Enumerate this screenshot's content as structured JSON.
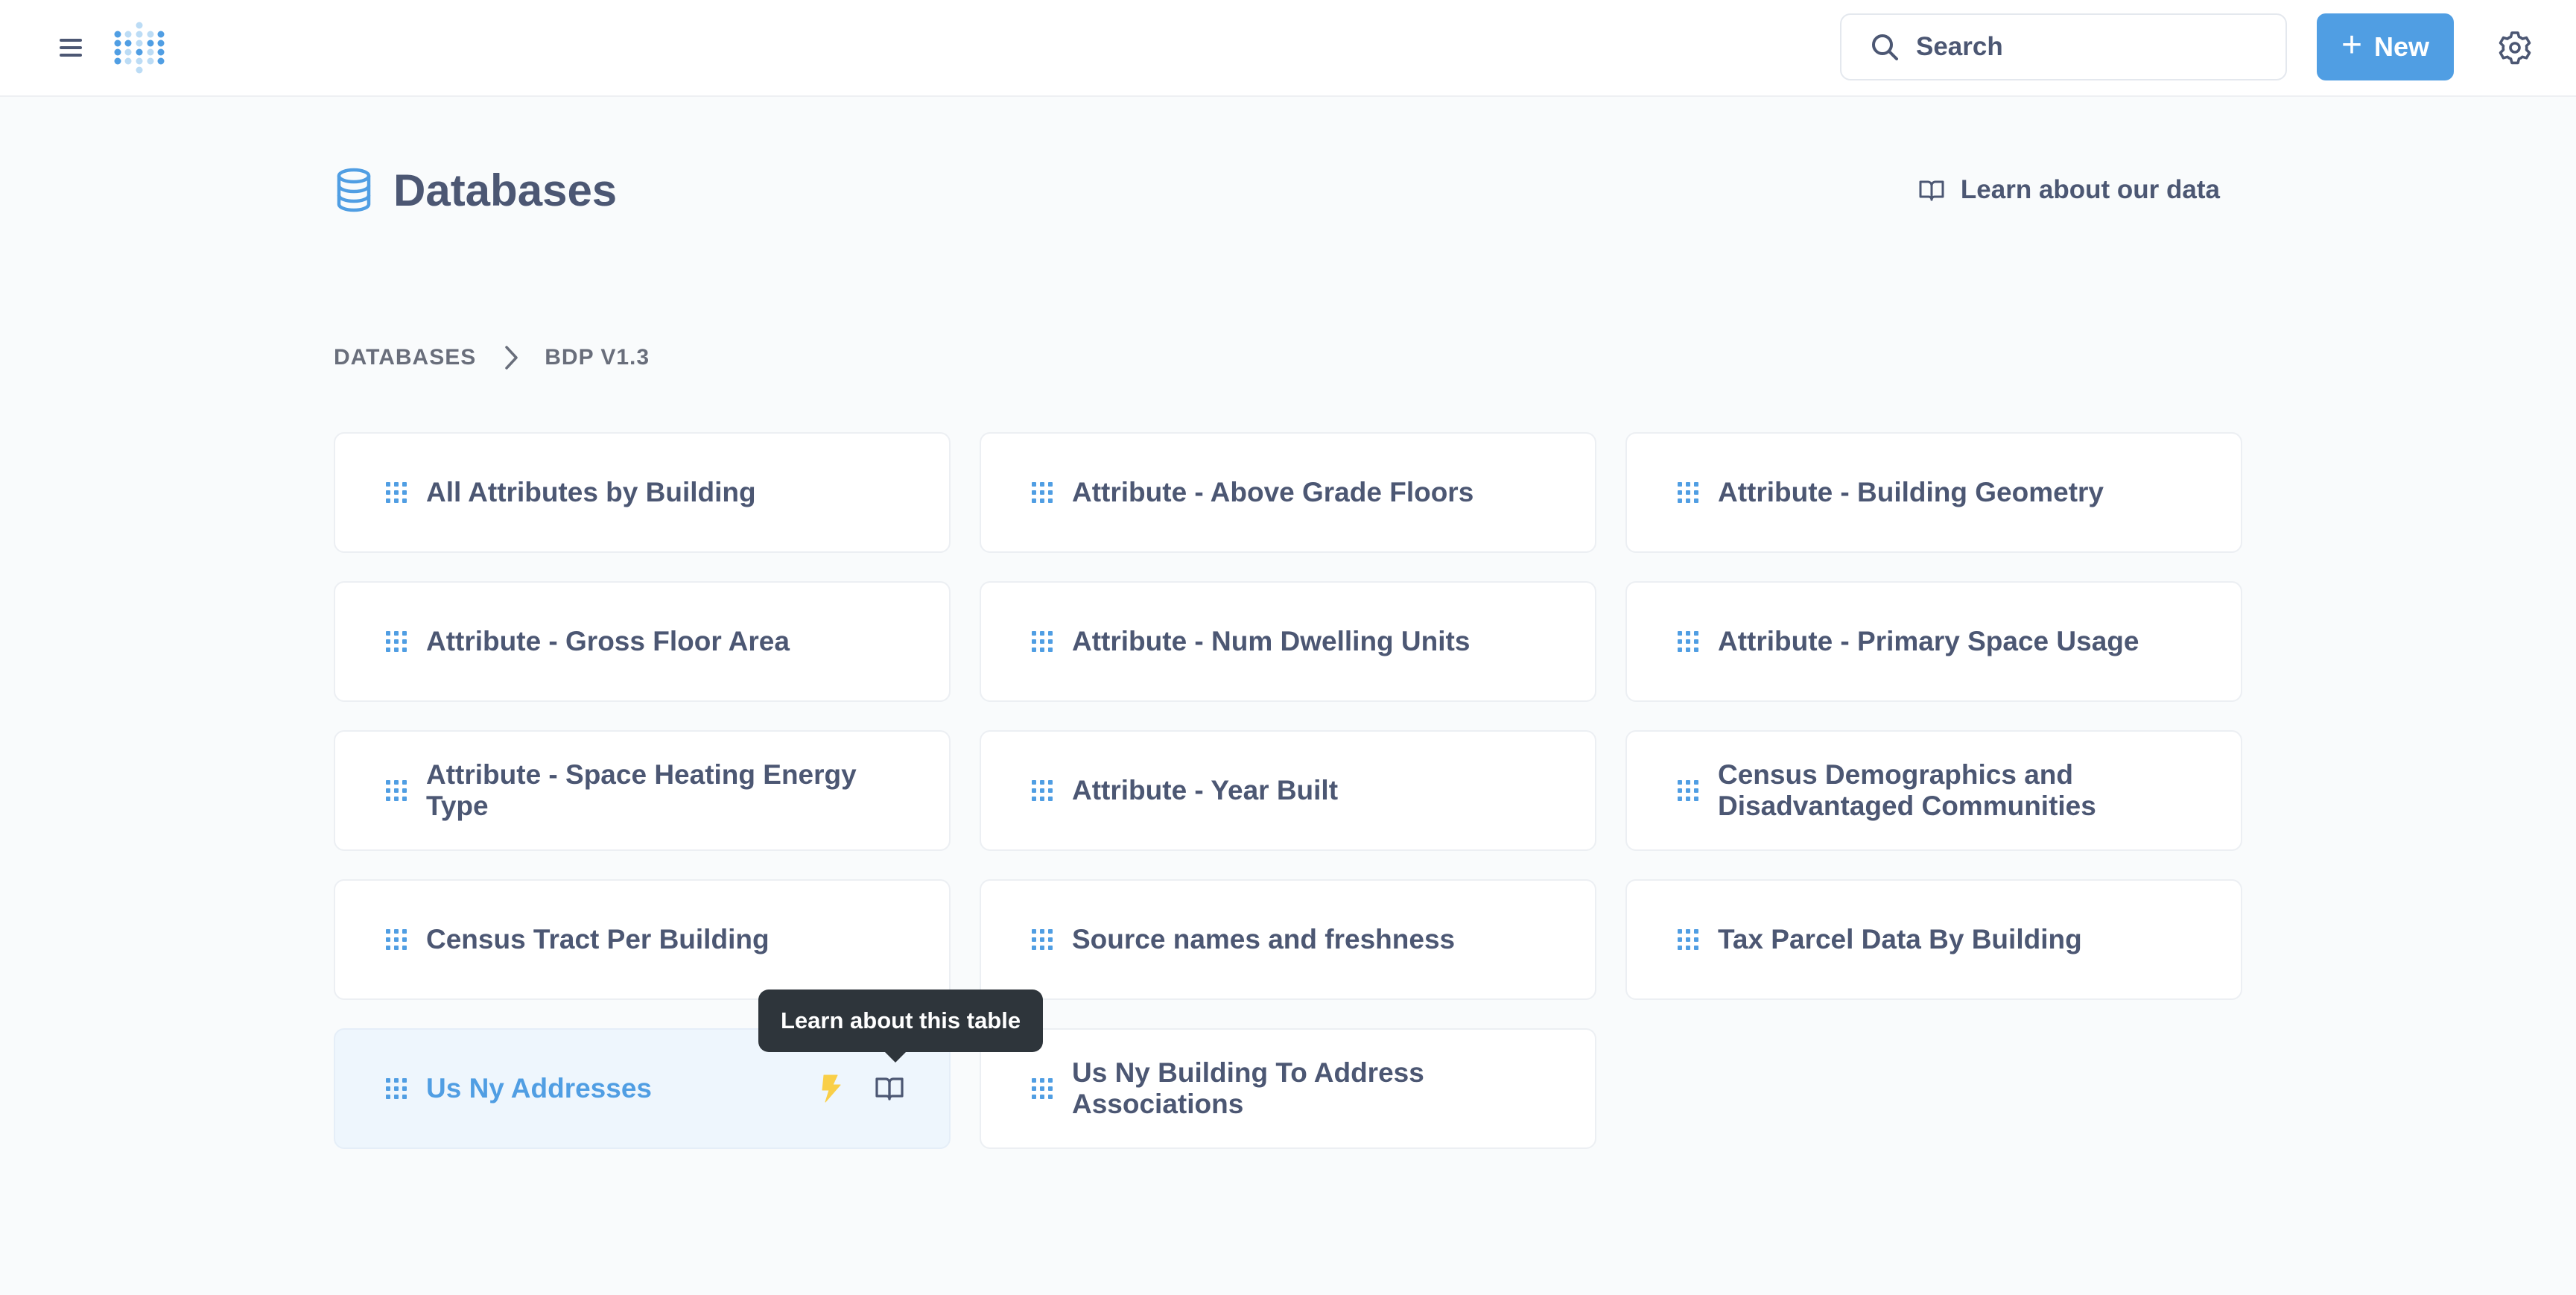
{
  "topbar": {
    "search_label": "Search",
    "new_label": "New",
    "brand_color": "#509ee3"
  },
  "header": {
    "title": "Databases",
    "learn_link": "Learn about our data"
  },
  "breadcrumb": {
    "root": "DATABASES",
    "current": "BDP V1.3"
  },
  "tables": [
    {
      "name": "All Attributes by Building"
    },
    {
      "name": "Attribute - Above Grade Floors"
    },
    {
      "name": "Attribute - Building Geometry"
    },
    {
      "name": "Attribute - Gross Floor Area"
    },
    {
      "name": "Attribute - Num Dwelling Units"
    },
    {
      "name": "Attribute - Primary Space Usage"
    },
    {
      "name": "Attribute - Space Heating Energy Type"
    },
    {
      "name": "Attribute - Year Built"
    },
    {
      "name": "Census Demographics and Disadvantaged Communities"
    },
    {
      "name": "Census Tract Per Building"
    },
    {
      "name": "Source names and freshness"
    },
    {
      "name": "Tax Parcel Data By Building"
    },
    {
      "name": "Us Ny Addresses",
      "hovered": true
    },
    {
      "name": "Us Ny Building To Address Associations"
    }
  ],
  "tooltip": {
    "text": "Learn about this table"
  },
  "icons": {
    "menu": "hamburger-icon",
    "logo": "metabase-logo",
    "search": "search-icon",
    "add": "plus-icon",
    "settings": "gear-icon",
    "database": "database-icon",
    "book": "book-icon",
    "table": "table-grid-icon",
    "xray": "bolt-icon"
  }
}
